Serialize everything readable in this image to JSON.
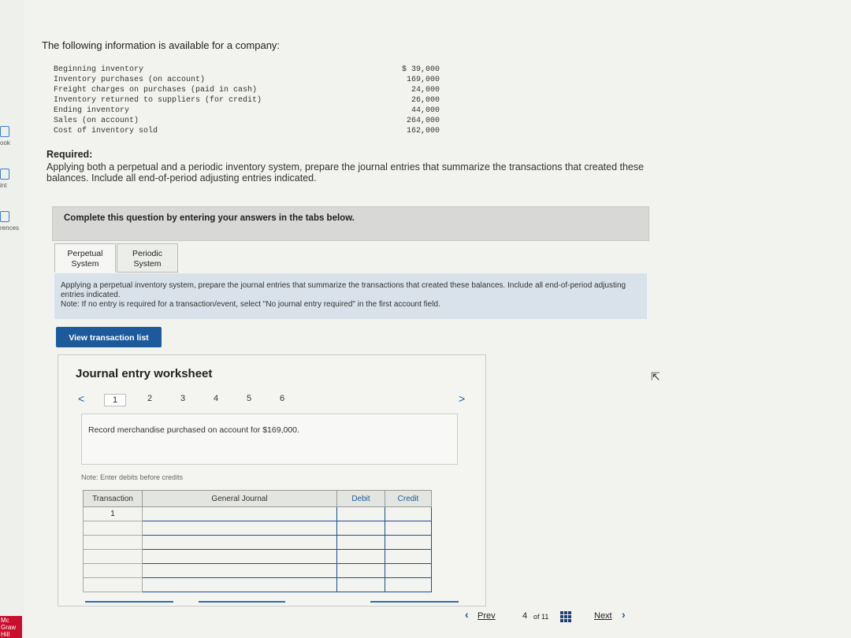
{
  "sidebar": {
    "items": [
      {
        "label": "ook"
      },
      {
        "label": "int"
      },
      {
        "label": "rences"
      }
    ],
    "logo": "Mc Graw Hill"
  },
  "intro": "The following information is available for a company:",
  "data_rows": [
    {
      "label": "Beginning inventory",
      "value": "$ 39,000"
    },
    {
      "label": "Inventory purchases (on account)",
      "value": "169,000"
    },
    {
      "label": "Freight charges on purchases (paid in cash)",
      "value": "24,000"
    },
    {
      "label": "Inventory returned to suppliers (for credit)",
      "value": "26,000"
    },
    {
      "label": "Ending inventory",
      "value": "44,000"
    },
    {
      "label": "Sales (on account)",
      "value": "264,000"
    },
    {
      "label": "Cost of inventory sold",
      "value": "162,000"
    }
  ],
  "required": {
    "heading": "Required:",
    "text": "Applying both a perpetual and a periodic inventory system, prepare the journal entries that summarize the transactions that created these balances. Include all end-of-period adjusting entries indicated."
  },
  "complete_bar": "Complete this question by entering your answers in the tabs below.",
  "tabs": [
    {
      "line1": "Perpetual",
      "line2": "System"
    },
    {
      "line1": "Periodic",
      "line2": "System"
    }
  ],
  "instructions": {
    "text": "Applying a perpetual inventory system, prepare the journal entries that summarize the transactions that created these balances. Include all end-of-period adjusting entries indicated.",
    "note": "Note: If no entry is required for a transaction/event, select \"No journal entry required\" in the first account field."
  },
  "view_button": "View transaction list",
  "worksheet": {
    "title": "Journal entry worksheet",
    "pages": [
      "1",
      "2",
      "3",
      "4",
      "5",
      "6"
    ],
    "prev": "<",
    "next": ">",
    "description": "Record merchandise purchased on account for $169,000.",
    "note": "Note: Enter debits before credits",
    "columns": {
      "transaction": "Transaction",
      "general_journal": "General Journal",
      "debit": "Debit",
      "credit": "Credit"
    },
    "first_transaction": "1"
  },
  "footer": {
    "prev": "Prev",
    "page": "4",
    "of": "of 11",
    "next": "Next"
  },
  "colors": {
    "accent": "#1d5a9c",
    "instructions_bg": "#d9e2ea",
    "complete_bar_bg": "#d8d9d6"
  }
}
